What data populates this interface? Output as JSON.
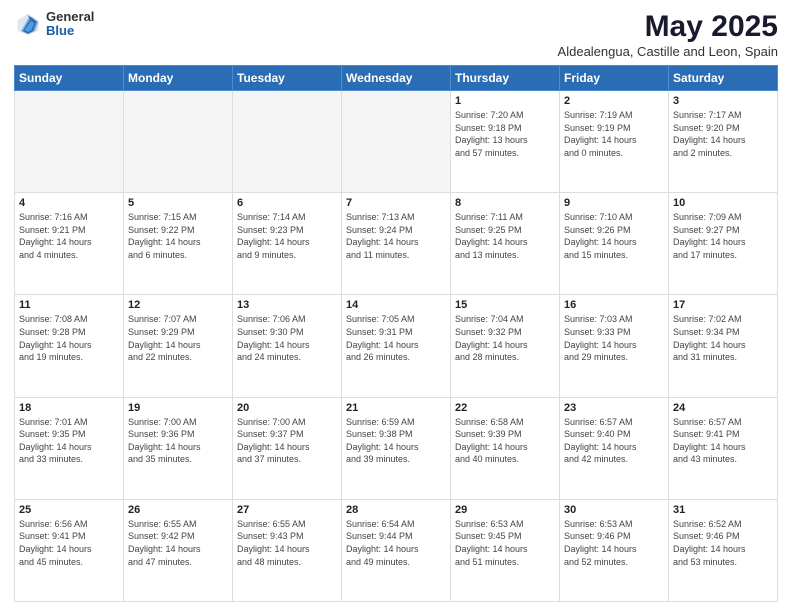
{
  "header": {
    "logo_general": "General",
    "logo_blue": "Blue",
    "title": "May 2025",
    "location": "Aldealengua, Castille and Leon, Spain"
  },
  "weekdays": [
    "Sunday",
    "Monday",
    "Tuesday",
    "Wednesday",
    "Thursday",
    "Friday",
    "Saturday"
  ],
  "weeks": [
    [
      {
        "day": "",
        "info": ""
      },
      {
        "day": "",
        "info": ""
      },
      {
        "day": "",
        "info": ""
      },
      {
        "day": "",
        "info": ""
      },
      {
        "day": "1",
        "info": "Sunrise: 7:20 AM\nSunset: 9:18 PM\nDaylight: 13 hours\nand 57 minutes."
      },
      {
        "day": "2",
        "info": "Sunrise: 7:19 AM\nSunset: 9:19 PM\nDaylight: 14 hours\nand 0 minutes."
      },
      {
        "day": "3",
        "info": "Sunrise: 7:17 AM\nSunset: 9:20 PM\nDaylight: 14 hours\nand 2 minutes."
      }
    ],
    [
      {
        "day": "4",
        "info": "Sunrise: 7:16 AM\nSunset: 9:21 PM\nDaylight: 14 hours\nand 4 minutes."
      },
      {
        "day": "5",
        "info": "Sunrise: 7:15 AM\nSunset: 9:22 PM\nDaylight: 14 hours\nand 6 minutes."
      },
      {
        "day": "6",
        "info": "Sunrise: 7:14 AM\nSunset: 9:23 PM\nDaylight: 14 hours\nand 9 minutes."
      },
      {
        "day": "7",
        "info": "Sunrise: 7:13 AM\nSunset: 9:24 PM\nDaylight: 14 hours\nand 11 minutes."
      },
      {
        "day": "8",
        "info": "Sunrise: 7:11 AM\nSunset: 9:25 PM\nDaylight: 14 hours\nand 13 minutes."
      },
      {
        "day": "9",
        "info": "Sunrise: 7:10 AM\nSunset: 9:26 PM\nDaylight: 14 hours\nand 15 minutes."
      },
      {
        "day": "10",
        "info": "Sunrise: 7:09 AM\nSunset: 9:27 PM\nDaylight: 14 hours\nand 17 minutes."
      }
    ],
    [
      {
        "day": "11",
        "info": "Sunrise: 7:08 AM\nSunset: 9:28 PM\nDaylight: 14 hours\nand 19 minutes."
      },
      {
        "day": "12",
        "info": "Sunrise: 7:07 AM\nSunset: 9:29 PM\nDaylight: 14 hours\nand 22 minutes."
      },
      {
        "day": "13",
        "info": "Sunrise: 7:06 AM\nSunset: 9:30 PM\nDaylight: 14 hours\nand 24 minutes."
      },
      {
        "day": "14",
        "info": "Sunrise: 7:05 AM\nSunset: 9:31 PM\nDaylight: 14 hours\nand 26 minutes."
      },
      {
        "day": "15",
        "info": "Sunrise: 7:04 AM\nSunset: 9:32 PM\nDaylight: 14 hours\nand 28 minutes."
      },
      {
        "day": "16",
        "info": "Sunrise: 7:03 AM\nSunset: 9:33 PM\nDaylight: 14 hours\nand 29 minutes."
      },
      {
        "day": "17",
        "info": "Sunrise: 7:02 AM\nSunset: 9:34 PM\nDaylight: 14 hours\nand 31 minutes."
      }
    ],
    [
      {
        "day": "18",
        "info": "Sunrise: 7:01 AM\nSunset: 9:35 PM\nDaylight: 14 hours\nand 33 minutes."
      },
      {
        "day": "19",
        "info": "Sunrise: 7:00 AM\nSunset: 9:36 PM\nDaylight: 14 hours\nand 35 minutes."
      },
      {
        "day": "20",
        "info": "Sunrise: 7:00 AM\nSunset: 9:37 PM\nDaylight: 14 hours\nand 37 minutes."
      },
      {
        "day": "21",
        "info": "Sunrise: 6:59 AM\nSunset: 9:38 PM\nDaylight: 14 hours\nand 39 minutes."
      },
      {
        "day": "22",
        "info": "Sunrise: 6:58 AM\nSunset: 9:39 PM\nDaylight: 14 hours\nand 40 minutes."
      },
      {
        "day": "23",
        "info": "Sunrise: 6:57 AM\nSunset: 9:40 PM\nDaylight: 14 hours\nand 42 minutes."
      },
      {
        "day": "24",
        "info": "Sunrise: 6:57 AM\nSunset: 9:41 PM\nDaylight: 14 hours\nand 43 minutes."
      }
    ],
    [
      {
        "day": "25",
        "info": "Sunrise: 6:56 AM\nSunset: 9:41 PM\nDaylight: 14 hours\nand 45 minutes."
      },
      {
        "day": "26",
        "info": "Sunrise: 6:55 AM\nSunset: 9:42 PM\nDaylight: 14 hours\nand 47 minutes."
      },
      {
        "day": "27",
        "info": "Sunrise: 6:55 AM\nSunset: 9:43 PM\nDaylight: 14 hours\nand 48 minutes."
      },
      {
        "day": "28",
        "info": "Sunrise: 6:54 AM\nSunset: 9:44 PM\nDaylight: 14 hours\nand 49 minutes."
      },
      {
        "day": "29",
        "info": "Sunrise: 6:53 AM\nSunset: 9:45 PM\nDaylight: 14 hours\nand 51 minutes."
      },
      {
        "day": "30",
        "info": "Sunrise: 6:53 AM\nSunset: 9:46 PM\nDaylight: 14 hours\nand 52 minutes."
      },
      {
        "day": "31",
        "info": "Sunrise: 6:52 AM\nSunset: 9:46 PM\nDaylight: 14 hours\nand 53 minutes."
      }
    ]
  ]
}
